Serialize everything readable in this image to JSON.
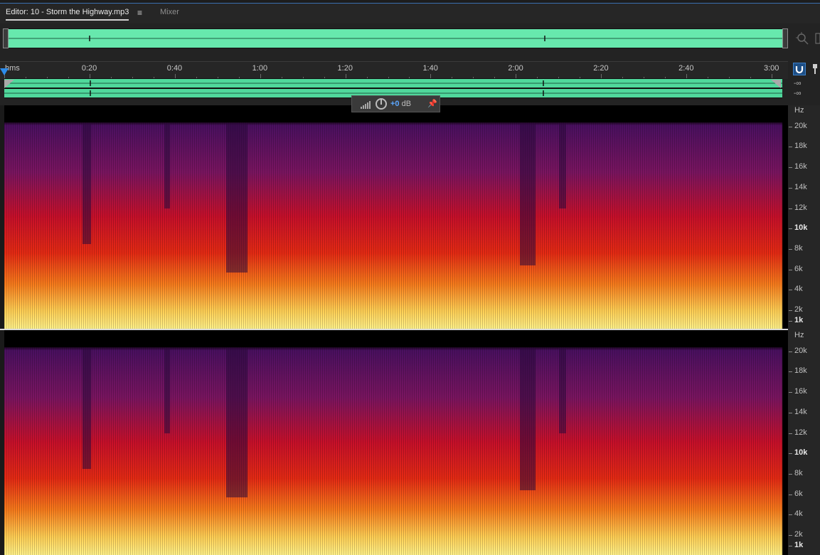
{
  "tabs": {
    "editor_label": "Editor: 10 - Storm the Highway.mp3",
    "menu_icon": "≡",
    "mixer_label": "Mixer"
  },
  "timeline": {
    "unit": "hms",
    "labels": [
      "0:20",
      "0:40",
      "1:00",
      "1:20",
      "1:40",
      "2:00",
      "2:20",
      "2:40",
      "3:00"
    ],
    "duration_seconds": 182
  },
  "track": {
    "channel_db": [
      "-∞",
      "-∞"
    ]
  },
  "hud": {
    "gain_value": "+0",
    "gain_unit": " dB"
  },
  "frequency_axis": {
    "unit": "Hz",
    "labels": [
      "20k",
      "18k",
      "16k",
      "14k",
      "12k",
      "10k",
      "8k",
      "6k",
      "4k",
      "2k",
      "1k"
    ],
    "bold_labels": [
      "10k",
      "1k"
    ]
  },
  "colors": {
    "waveform": "#5ee3a9",
    "accent": "#2d8ceb",
    "spectrogram_low": "#ffd35c",
    "spectrogram_mid": "#e0201a",
    "spectrogram_high": "#5a1a6e"
  },
  "icons": [
    "hamburger-menu-icon",
    "zoom-icon",
    "snap-icon",
    "marker-icon",
    "level-meter-icon",
    "gain-knob-icon",
    "pin-icon"
  ]
}
